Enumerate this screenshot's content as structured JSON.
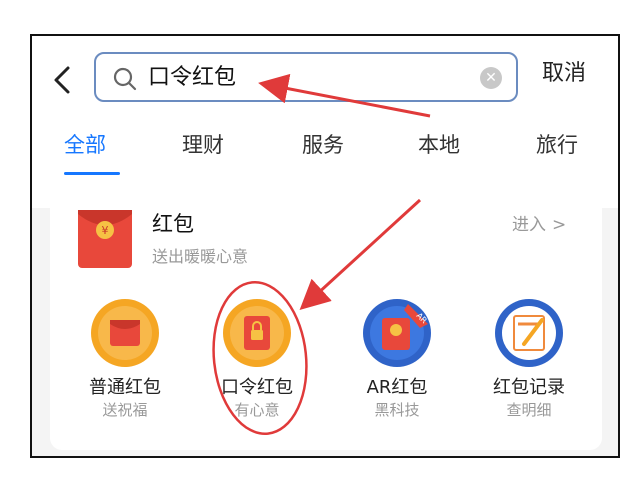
{
  "search": {
    "query": "口令红包",
    "clear_icon": "clear-icon"
  },
  "header": {
    "cancel_label": "取消",
    "back_icon": "chevron-left-icon"
  },
  "tabs": [
    {
      "label": "全部",
      "active": true
    },
    {
      "label": "理财",
      "active": false
    },
    {
      "label": "服务",
      "active": false
    },
    {
      "label": "本地",
      "active": false
    },
    {
      "label": "旅行",
      "active": false
    }
  ],
  "card": {
    "title": "红包",
    "subtitle": "送出暖暖心意",
    "enter_label": "进入",
    "items": [
      {
        "name": "普通红包",
        "desc": "送祝福",
        "icon": "red-envelope-icon"
      },
      {
        "name": "口令红包",
        "desc": "有心意",
        "icon": "password-envelope-icon"
      },
      {
        "name": "AR红包",
        "desc": "黑科技",
        "icon": "ar-envelope-icon"
      },
      {
        "name": "红包记录",
        "desc": "查明细",
        "icon": "record-icon"
      }
    ]
  },
  "colors": {
    "accent": "#1677ff",
    "annotation": "#e03a3a",
    "envelope_red": "#e8483b",
    "gold": "#f5a623"
  }
}
